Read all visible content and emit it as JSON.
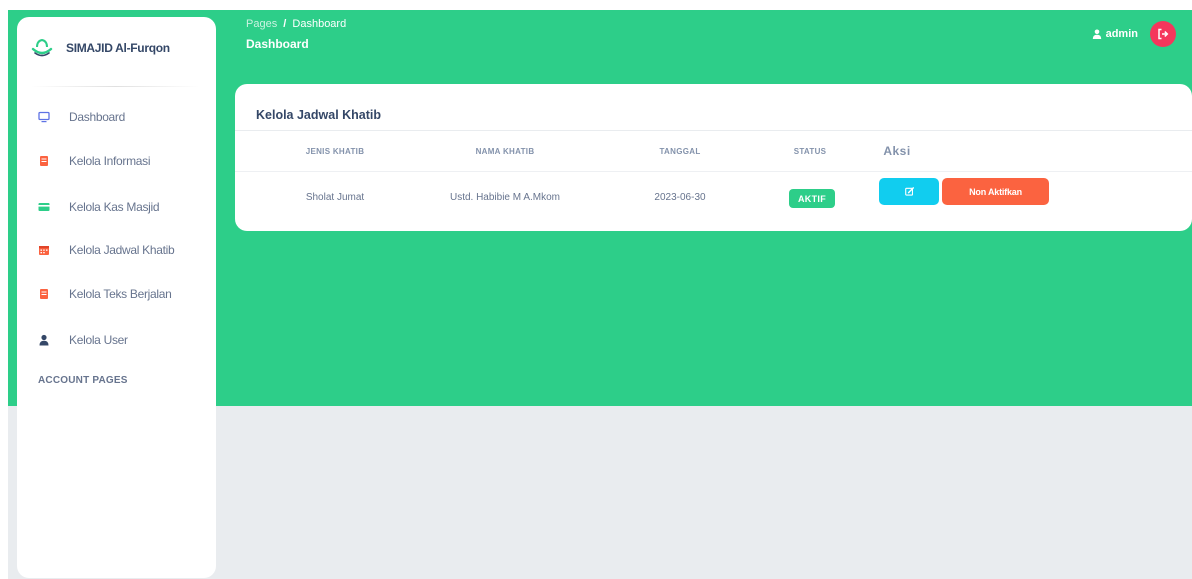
{
  "brand": {
    "name": "SIMAJID Al-Furqon"
  },
  "sidebar": {
    "items": [
      {
        "label": "Dashboard",
        "icon": "monitor-icon",
        "color": "#5e72e4"
      },
      {
        "label": "Kelola Informasi",
        "icon": "document-icon",
        "color": "#fb6340"
      },
      {
        "label": "Kelola Kas Masjid",
        "icon": "credit-card-icon",
        "color": "#2dce89"
      },
      {
        "label": "Kelola Jadwal Khatib",
        "icon": "calendar-icon",
        "color": "#fb6340"
      },
      {
        "label": "Kelola Teks Berjalan",
        "icon": "document-icon",
        "color": "#fb6340"
      },
      {
        "label": "Kelola User",
        "icon": "user-icon",
        "color": "#344767"
      }
    ],
    "section_label": "ACCOUNT PAGES"
  },
  "header": {
    "breadcrumb_root": "Pages",
    "breadcrumb_separator": "/",
    "breadcrumb_current": "Dashboard",
    "title": "Dashboard",
    "user_name": "admin"
  },
  "card": {
    "title": "Kelola Jadwal Khatib",
    "columns": [
      "JENIS KHATIB",
      "NAMA KHATIB",
      "TANGGAL",
      "STATUS",
      "Aksi"
    ],
    "rows": [
      {
        "jenis": "Sholat Jumat",
        "nama": "Ustd. Habibie M A.Mkom",
        "tanggal": "2023-06-30",
        "status": "AKTIF",
        "deactivate_label": "Non Aktifkan"
      }
    ]
  },
  "colors": {
    "primary_green": "#2dce89",
    "info": "#11cdef",
    "warning": "#fb6340",
    "danger": "#f5365c",
    "text_dark": "#344767",
    "text_muted": "#67748e"
  }
}
